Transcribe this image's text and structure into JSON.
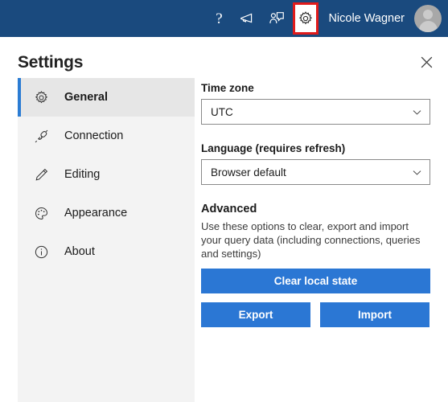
{
  "topbar": {
    "help_glyph": "?",
    "help_label": "Help",
    "announcements_label": "Announcements",
    "feedback_label": "Feedback",
    "settings_label": "Settings",
    "username": "Nicole Wagner",
    "avatar_label": "User avatar",
    "background_color": "#1a4a7e",
    "highlight_color": "#e01b1b"
  },
  "panel": {
    "title": "Settings",
    "close_label": "Close"
  },
  "sidebar": {
    "items": [
      {
        "label": "General",
        "icon": "gear-icon",
        "active": true
      },
      {
        "label": "Connection",
        "icon": "plug-icon",
        "active": false
      },
      {
        "label": "Editing",
        "icon": "pencil-icon",
        "active": false
      },
      {
        "label": "Appearance",
        "icon": "palette-icon",
        "active": false
      },
      {
        "label": "About",
        "icon": "info-icon",
        "active": false
      }
    ]
  },
  "main": {
    "timezone": {
      "label": "Time zone",
      "value": "UTC"
    },
    "language": {
      "label": "Language (requires refresh)",
      "value": "Browser default"
    },
    "advanced": {
      "title": "Advanced",
      "description": "Use these options to clear, export and import your query data (including connections, queries and settings)",
      "clear_label": "Clear local state",
      "export_label": "Export",
      "import_label": "Import",
      "button_color": "#2b77d4"
    }
  }
}
